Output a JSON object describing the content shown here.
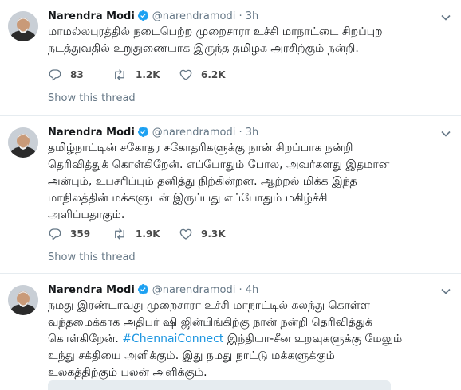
{
  "tweets": [
    {
      "name": "Narendra Modi",
      "handle": "@narendramodi",
      "separator": "·",
      "time": "3h",
      "text_lines": [
        "மாமல்லபுரத்தில் நடைபெற்ற முறைசாரா உச்சி மாநாட்டை சிறப்புற",
        "நடத்துவதில் உறுதுணையாக இருந்த தமிழக அரசிற்கும் நன்றி."
      ],
      "replies": "83",
      "retweets": "1.2K",
      "likes": "6.2K",
      "show_thread": "Show this thread"
    },
    {
      "name": "Narendra Modi",
      "handle": "@narendramodi",
      "separator": "·",
      "time": "3h",
      "text_lines": [
        "தமிழ்நாட்டின் சகோதர சகோதரிகளுக்கு நான் சிறப்பாக நன்றி",
        "தெரிவித்துக் கொள்கிறேன். எப்போதும் போல, அவர்களது இதமான",
        "அன்பும், உபசரிப்பும் தனித்து நிற்கின்றன. ஆற்றல் மிக்க இந்த",
        "மாநிலத்தின் மக்களுடன் இருப்பது எப்போதும் மகிழ்ச்சி",
        "அளிப்பதாகும்."
      ],
      "replies": "359",
      "retweets": "1.9K",
      "likes": "9.3K",
      "show_thread": "Show this thread"
    },
    {
      "name": "Narendra Modi",
      "handle": "@narendramodi",
      "separator": "·",
      "time": "4h",
      "text_line1": "நமது இரண்டாவது முறைசாரா உச்சி மாநாட்டில் கலந்து கொள்ள",
      "text_line2": "வந்தமைக்காக அதிபர் ஷி ஜின்பிங்கிற்கு நான் நன்றி தெரிவித்துக்",
      "text_line3_pre": "கொள்கிறேன். ",
      "hashtag": "#ChennaiConnect",
      "text_line3_post": " இந்தியா-சீன உறவுகளுக்கு மேலும்",
      "text_line4": "உந்து சக்தியை அளிக்கும். இது நமது நாட்டு மக்களுக்கும்",
      "text_line5": "உலகத்திற்கும் பலன் அளிக்கும்."
    }
  ],
  "colors": {
    "verified": "#1da1f2",
    "link": "#1b95e0",
    "muted": "#657786",
    "divider": "#e6ecf0"
  },
  "icons": [
    "verified-badge-icon",
    "caret-down-icon",
    "reply-icon",
    "retweet-icon",
    "like-icon"
  ]
}
